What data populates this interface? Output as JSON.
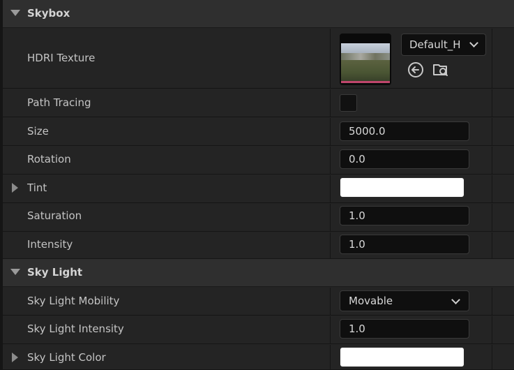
{
  "sections": {
    "skybox": "Skybox",
    "sky_light": "Sky Light"
  },
  "skybox": {
    "hdri_texture": {
      "label": "HDRI Texture",
      "asset": "Default_H"
    },
    "path_tracing": {
      "label": "Path Tracing",
      "checked": false
    },
    "size": {
      "label": "Size",
      "value": "5000.0"
    },
    "rotation": {
      "label": "Rotation",
      "value": "0.0"
    },
    "tint": {
      "label": "Tint",
      "color": "#ffffff"
    },
    "saturation": {
      "label": "Saturation",
      "value": "1.0"
    },
    "intensity": {
      "label": "Intensity",
      "value": "1.0"
    }
  },
  "sky_light": {
    "mobility": {
      "label": "Sky Light Mobility",
      "value": "Movable"
    },
    "intensity": {
      "label": "Sky Light Intensity",
      "value": "1.0"
    },
    "color": {
      "label": "Sky Light Color",
      "color": "#ffffff"
    }
  },
  "icons": {
    "browse": "use-selected-arrow-icon",
    "find": "browse-folder-icon"
  },
  "colors": {
    "thumbnail_accent": "#c0466d"
  }
}
